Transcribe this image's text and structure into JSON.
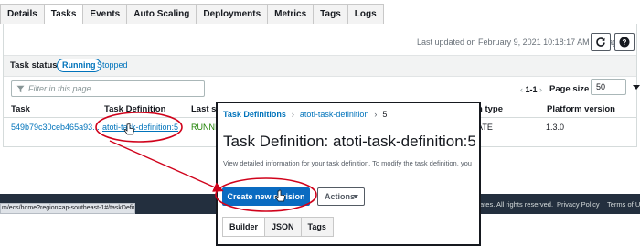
{
  "tabs": [
    "Details",
    "Tasks",
    "Events",
    "Auto Scaling",
    "Deployments",
    "Metrics",
    "Tags",
    "Logs"
  ],
  "active_tab": "Tasks",
  "header": {
    "last_updated": "Last updated on February 9, 2021 10:18:17 AM (0m ago)"
  },
  "status_filter": {
    "label": "Task status:",
    "running": "Running",
    "stopped": "Stopped"
  },
  "filter": {
    "placeholder": "Filter in this page"
  },
  "pagination": {
    "range": "1-1",
    "page_size_label": "Page size",
    "page_size": "50"
  },
  "table": {
    "columns": {
      "task": "Task",
      "task_definition": "Task Definition",
      "last_status": "Last st",
      "launch_type": "h type",
      "platform_version": "Platform version"
    },
    "row": {
      "task": "549b79c30ceb465a93...",
      "task_definition": "atoti-task-definition:5",
      "last_status": "RUNNI",
      "launch_type": "ATE",
      "platform_version": "1.3.0"
    }
  },
  "footer": {
    "status_url": "m/ecs/home?region=ap-southeast-1#/taskDefini",
    "rights": "ffiliates. All rights reserved.",
    "privacy": "Privacy Policy",
    "terms": "Terms of Us"
  },
  "overlay": {
    "breadcrumb": [
      "Task Definitions",
      "atoti-task-definition",
      "5"
    ],
    "breadcrumb_sep": "›",
    "title": "Task Definition: atoti-task-definition:5",
    "description": "View detailed information for your task definition. To modify the task definition, you",
    "create_button": "Create new revision",
    "actions_button": "Actions",
    "tabs": [
      "Builder",
      "JSON",
      "Tags"
    ]
  },
  "colors": {
    "link": "#0073bb",
    "running": "#1d8102",
    "primary_button": "#0a6bc1",
    "footer_bg": "#232f3e",
    "annotation": "#d0021b"
  },
  "icons": [
    "refresh-icon",
    "help-icon",
    "filter-icon",
    "caret-down-icon",
    "chevron-left-icon",
    "chevron-right-icon",
    "hand-cursor-icon"
  ]
}
